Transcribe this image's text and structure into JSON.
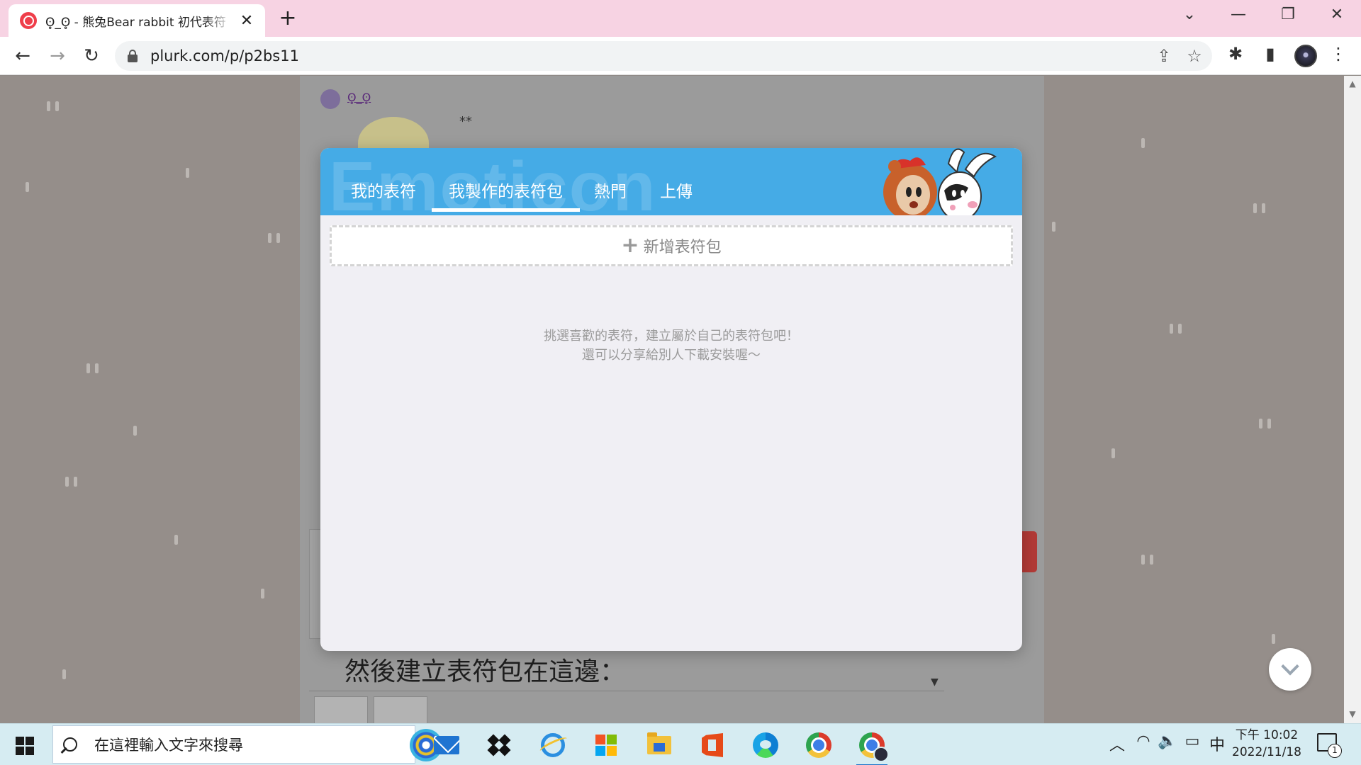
{
  "browser": {
    "tab": {
      "title": "ʘ̥_ʘ̥ - 熊兔Bear rabbit 初代表符",
      "close": "✕"
    },
    "new_tab": "+",
    "window": {
      "tab_search": "⌄",
      "minimize": "—",
      "restore": "❐",
      "close": "✕"
    },
    "toolbar": {
      "back": "←",
      "forward": "→",
      "reload": "↻",
      "url": "plurk.com/p/p2bs11",
      "share": "⇪",
      "bookmark": "☆",
      "extensions": "✱",
      "side_panel": "▮",
      "menu": "⋮"
    }
  },
  "background": {
    "author_name": "ʘ̥_ʘ̥",
    "post_stars": "**",
    "caption": "然後建立表符包在這邊：",
    "dropdown_arrow": "▼"
  },
  "modal": {
    "watermark": "Emoticon",
    "tabs": [
      {
        "label": "我的表符",
        "active": false
      },
      {
        "label": "我製作的表符包",
        "active": true
      },
      {
        "label": "熱門",
        "active": false
      },
      {
        "label": "上傳",
        "active": false
      }
    ],
    "add_pack": {
      "icon": "+",
      "label": "新增表符包"
    },
    "empty_message": [
      "挑選喜歡的表符，建立屬於自己的表符包吧！",
      "還可以分享給別人下載安裝喔～"
    ],
    "colors": {
      "header": "#45abe6",
      "body": "#f0eff4"
    }
  },
  "scrollbar": {
    "up": "▲",
    "down": "▼"
  },
  "taskbar": {
    "search_placeholder": "在這裡輸入文字來搜尋",
    "tray": {
      "chevron": "︿",
      "wifi": "◠",
      "volume": "🔈",
      "battery": "▭",
      "ime": "中"
    },
    "clock": {
      "time": "下午 10:02",
      "date": "2022/11/18"
    },
    "notifications": "1"
  }
}
